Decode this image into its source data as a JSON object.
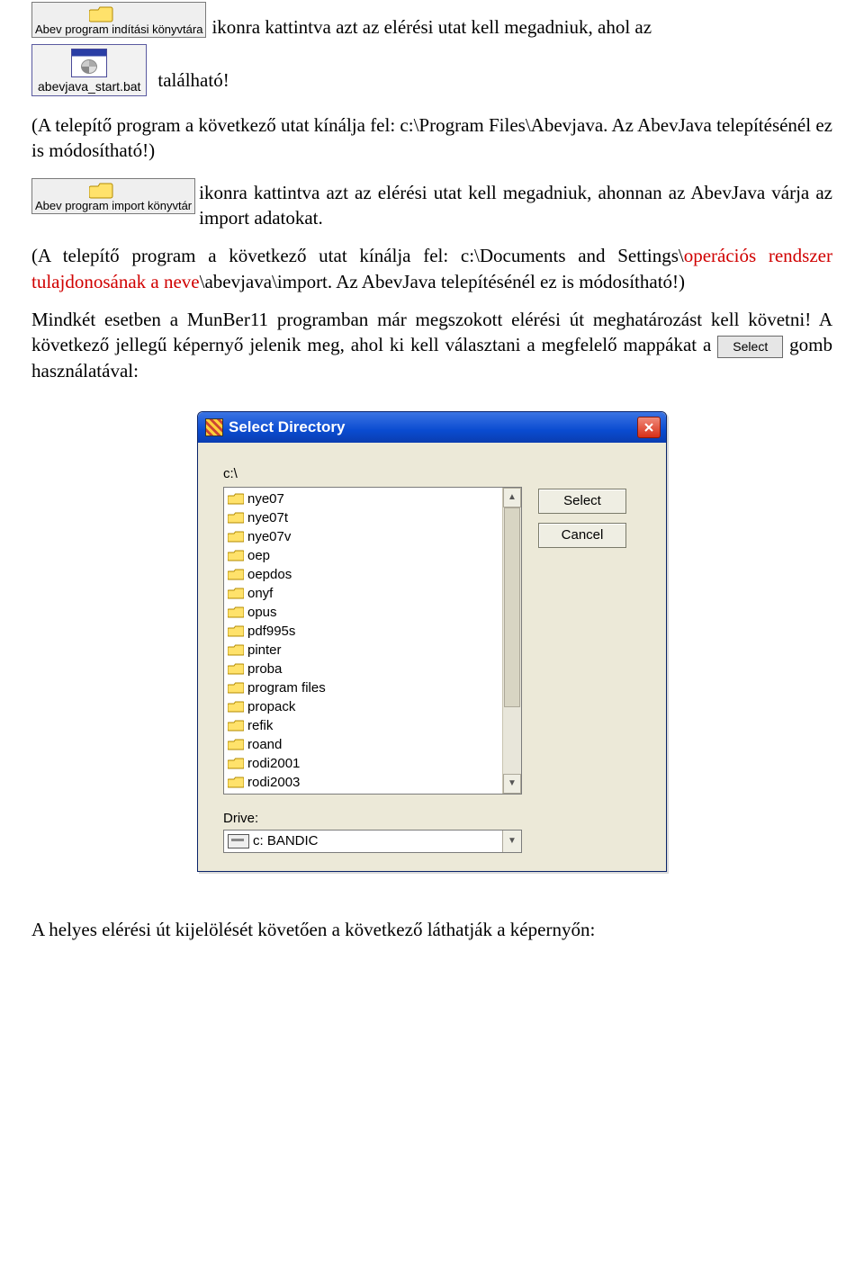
{
  "chip1": {
    "label": "Abev program indítási könyvtára",
    "after": " ikonra kattintva azt az elérési utat kell megadniuk, ahol az"
  },
  "bat": {
    "label": "abevjava_start.bat",
    "after": "található!"
  },
  "para1": "(A telepítő program a következő utat kínálja fel: c:\\Program Files\\Abevjava. Az AbevJava telepítésénél ez is módosítható!)",
  "chip2": {
    "label": "Abev program import könyvtár",
    "after": " ikonra kattintva azt az elérési utat kell megadniuk, ahonnan az AbevJava várja az import adatokat."
  },
  "para2": {
    "pre": "(A telepítő program a következő utat kínálja fel: c:\\Documents and Settings\\",
    "red": "operációs rendszer tulajdonosának a neve",
    "post": "\\abevjava\\import. Az AbevJava telepítésénél ez is módosítható!)"
  },
  "para3": {
    "pre": "Mindkét esetben a MunBer11 programban már megszokott elérési út meghatározást kell követni! A következő jellegű képernyő jelenik meg, ahol ki kell választani a megfelelő mappákat a ",
    "button": "Select",
    "post": " gomb használatával:"
  },
  "dialog": {
    "title": "Select Directory",
    "path": "c:\\",
    "items": [
      "nye07",
      "nye07t",
      "nye07v",
      "oep",
      "oepdos",
      "onyf",
      "opus",
      "pdf995s",
      "pinter",
      "proba",
      "program files",
      "propack",
      "refik",
      "roand",
      "rodi2001",
      "rodi2003"
    ],
    "select": "Select",
    "cancel": "Cancel",
    "drive_label": "Drive:",
    "drive_value": "c: BANDIC"
  },
  "tail": "A helyes elérési út kijelölését követően a következő láthatják a képernyőn:"
}
